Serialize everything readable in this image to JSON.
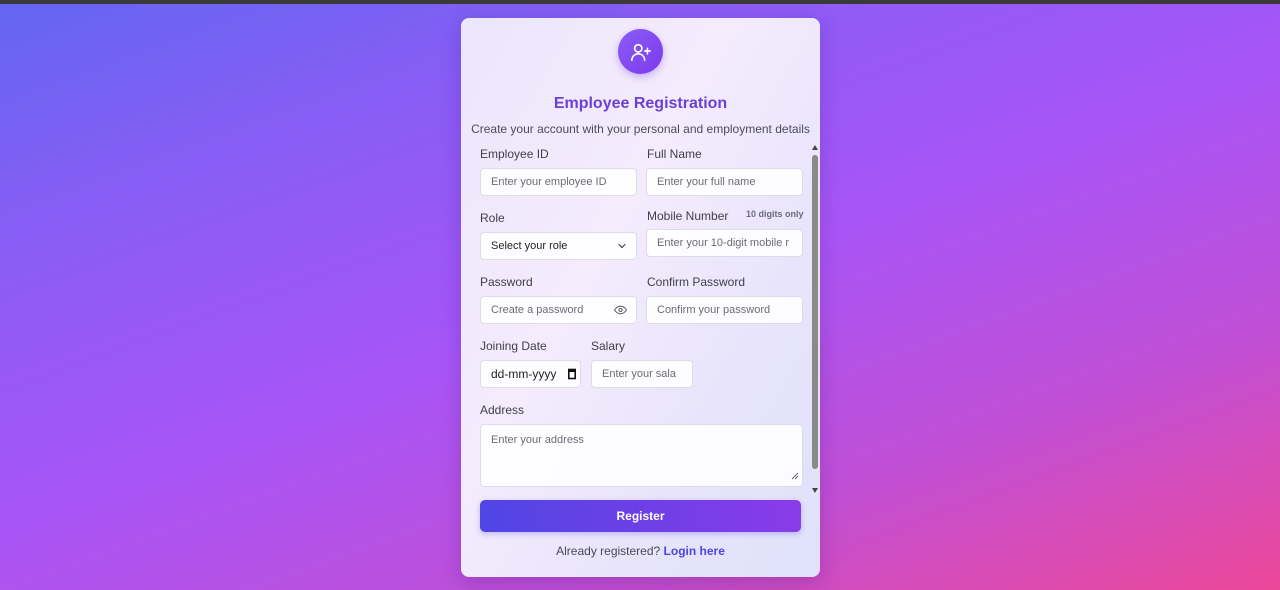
{
  "header": {
    "avatar_icon": "user-plus-icon",
    "title": "Employee Registration",
    "subtitle": "Create your account with your personal and employment details"
  },
  "form": {
    "employee_id": {
      "label": "Employee ID",
      "placeholder": "Enter your employee ID"
    },
    "full_name": {
      "label": "Full Name",
      "placeholder": "Enter your full name"
    },
    "role": {
      "label": "Role",
      "value": "Select your role"
    },
    "mobile": {
      "label": "Mobile Number",
      "hint": "10 digits only",
      "placeholder": "Enter your 10-digit mobile r"
    },
    "password": {
      "label": "Password",
      "placeholder": "Create a password",
      "icon": "eye-icon"
    },
    "confirm_password": {
      "label": "Confirm Password",
      "placeholder": "Confirm your password"
    },
    "joining_date": {
      "label": "Joining Date",
      "value": "dd-mm-yyyy",
      "icon": "calendar-icon"
    },
    "salary": {
      "label": "Salary",
      "placeholder": "Enter your sala"
    },
    "address": {
      "label": "Address",
      "placeholder": "Enter your address"
    }
  },
  "actions": {
    "register_label": "Register"
  },
  "footer": {
    "text": "Already registered?",
    "link": "Login here"
  },
  "colors": {
    "accent": "#6d3fd6",
    "button_start": "#4f46e5",
    "button_end": "#8b3be8",
    "link": "#4f46e5"
  }
}
